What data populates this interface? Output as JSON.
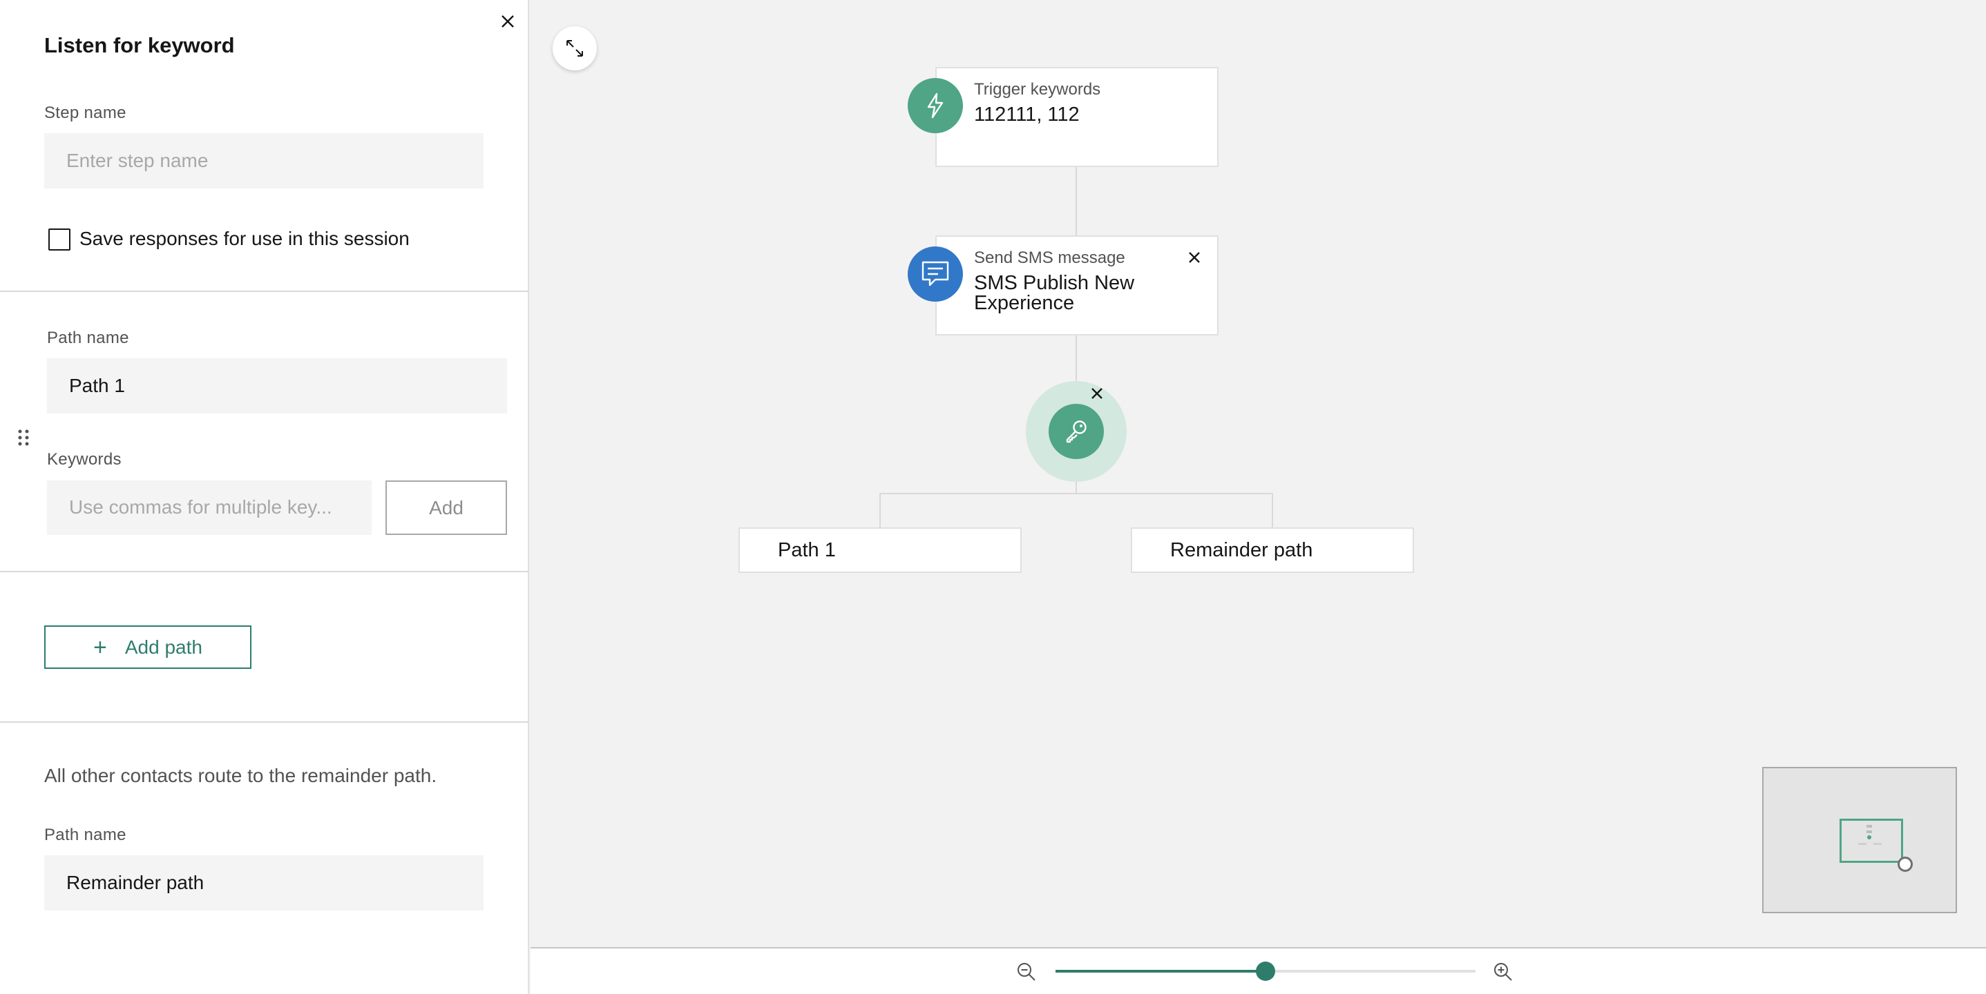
{
  "panel": {
    "title": "Listen for keyword",
    "step_name_label": "Step name",
    "step_name_placeholder": "Enter step name",
    "step_name_value": "",
    "save_responses_label": "Save responses for use in this session",
    "save_responses_checked": false,
    "path": {
      "path_name_label": "Path name",
      "path_name_value": "Path 1",
      "keywords_label": "Keywords",
      "keywords_placeholder": "Use commas for multiple key...",
      "add_label": "Add"
    },
    "add_path_label": "Add path",
    "remainder_note": "All other contacts route to the remainder path.",
    "remainder_path_name_label": "Path name",
    "remainder_path_name_value": "Remainder path"
  },
  "canvas": {
    "trigger": {
      "type": "Trigger keywords",
      "value": "112111, 112"
    },
    "sms": {
      "type": "Send SMS message",
      "value_line1": "SMS Publish New",
      "value_line2": "Experience"
    },
    "paths": [
      "Path 1",
      "Remainder path"
    ]
  },
  "zoom": {
    "level": 0.5
  },
  "colors": {
    "accent": "#2e7d6b",
    "trigger": "#4fa585",
    "sms": "#3278c8"
  },
  "icons": [
    "close-icon",
    "drag-handle-icon",
    "plus-icon",
    "expand-icon",
    "lightning-icon",
    "chat-icon",
    "key-icon",
    "zoom-out-icon",
    "zoom-in-icon"
  ]
}
